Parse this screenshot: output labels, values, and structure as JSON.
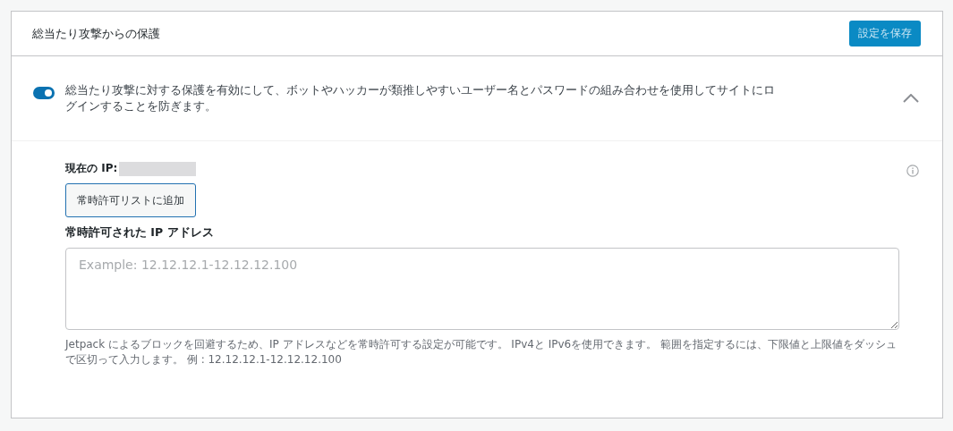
{
  "card": {
    "title": "総当たり攻撃からの保護",
    "save_button": "設定を保存"
  },
  "toggle": {
    "on": true,
    "label": "総当たり攻撃に対する保護を有効にして、ボットやハッカーが類推しやすいユーザー名とパスワードの組み合わせを使用してサイトにログインすることを防ぎます。",
    "expanded": true
  },
  "current_ip": {
    "label": "現在の IP:"
  },
  "add_button": "常時許可リストに追加",
  "allowlist": {
    "label": "常時許可された IP アドレス",
    "placeholder": "Example: 12.12.12.1-12.12.12.100",
    "help": "Jetpack によるブロックを回避するため、IP アドレスなどを常時許可する設定が可能です。 IPv4と IPv6を使用できます。 範囲を指定するには、下限値と上限値をダッシュで区切って入力します。 例 : 12.12.12.1-12.12.12.100"
  }
}
